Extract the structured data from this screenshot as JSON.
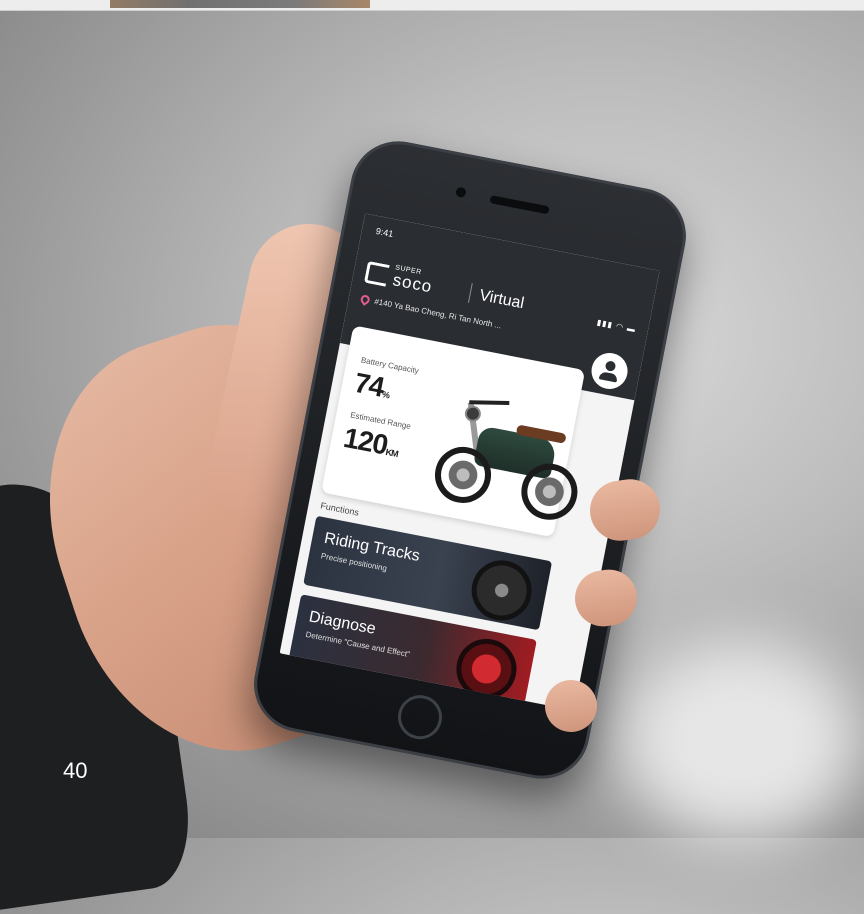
{
  "page": {
    "number": "40"
  },
  "app": {
    "status_time": "9:41",
    "status_icons": "▮▮▮ ◠ ▬",
    "brand": {
      "super": "SUPER",
      "name": "soco"
    },
    "title": "Virtual",
    "address": "#140 Ya Bao Cheng, Ri Tan North ...",
    "icons": {
      "location": "map-pin-icon",
      "profile": "user-avatar-icon"
    }
  },
  "vehicle": {
    "battery_label": "Battery Capacity",
    "battery_value": "74",
    "battery_unit": "%",
    "range_label": "Estimated Range",
    "range_value": "120",
    "range_unit": "KM"
  },
  "functions": {
    "label": "Functions",
    "items": [
      {
        "title": "Riding Tracks",
        "subtitle": "Precise positioning"
      },
      {
        "title": "Diagnose",
        "subtitle": "Determine \"Cause and Effect\""
      }
    ]
  },
  "colors": {
    "header_bg": "#2a2d31",
    "pin_accent": "#e45d8f",
    "diagnose_red": "#a01c22"
  }
}
